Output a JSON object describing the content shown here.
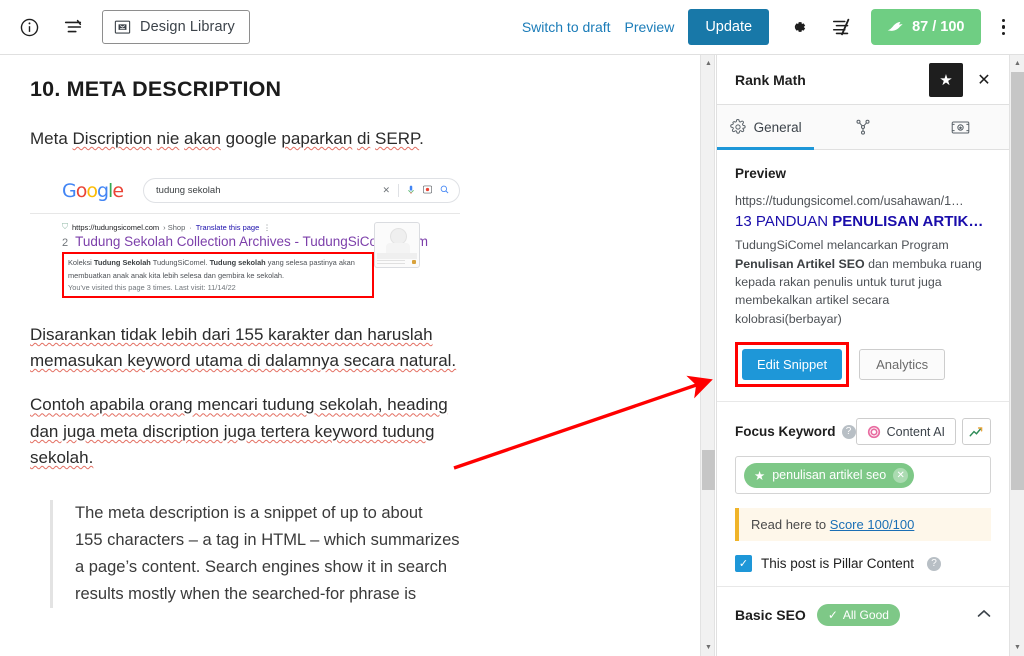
{
  "topbar": {
    "info_icon": "info-icon",
    "list_view_icon": "list-view-icon",
    "design_library_label": "Design Library",
    "design_library_icon": "design-library-icon",
    "switch_to_draft": "Switch to draft",
    "preview": "Preview",
    "update": "Update",
    "settings_icon": "gear-icon",
    "blocks_icon": "elementor-icon",
    "seo_score": "87 / 100",
    "seo_score_icon": "rank-math-icon",
    "more_icon": "kebab-menu-icon"
  },
  "editor": {
    "heading": "10. META DESCRIPTION",
    "paragraph1": "Meta Discription nie akan google paparkan di SERP.",
    "paragraph2_line1": "Disarankan tidak lebih dari 155 karakter dan haruslah",
    "paragraph2_line2": "memasukan keyword utama di dalamnya secara natural.",
    "paragraph3_line1": "Contoh apabila orang mencari tudung sekolah, heading",
    "paragraph3_line2": "dan juga meta discription juga tertera keyword tudung",
    "paragraph3_line3": "sekolah.",
    "quote_line1": "The meta description is a snippet of up to about",
    "quote_line2": "155 characters – a tag in HTML – which summarizes",
    "quote_line3": "a page’s content. Search engines show it in search",
    "quote_line4": "results mostly when the searched-for phrase is"
  },
  "serp": {
    "logo": "Google",
    "query": "tudung sekolah",
    "clear_icon": "close-icon",
    "mic_icon": "microphone-icon",
    "lens_icon": "google-lens-icon",
    "search_icon": "search-icon",
    "url": "https://tudungsicomel.com",
    "breadcrumb": "› Shop",
    "translate": "Translate this page",
    "rank": "2",
    "title": "Tudung Sekolah Collection Archives - TudungSiComel.com",
    "desc_prefix": "Koleksi ",
    "desc_bold1": "Tudung Sekolah",
    "desc_mid1": " TudungSiComel. ",
    "desc_bold2": "Tudung sekolah",
    "desc_rest": " yang selesa pastinya akan membuatkan anak anak kita lebih selesa dan gembira ke sekolah.",
    "visited": "You've visited this page 3 times. Last visit: 11/14/22"
  },
  "rankmath": {
    "title": "Rank Math",
    "star_icon": "star-icon",
    "close_icon": "close-icon",
    "tabs": [
      {
        "label": "General",
        "icon": "gear-icon",
        "active": true
      },
      {
        "label": "",
        "icon": "schema-share-icon",
        "active": false
      },
      {
        "label": "",
        "icon": "social-image-icon",
        "active": false
      }
    ],
    "preview_label": "Preview",
    "preview_url": "https://tudungsicomel.com/usahawan/1…",
    "preview_title_plain": "13 PANDUAN ",
    "preview_title_bold": "PENULISAN ARTIK…",
    "preview_desc_1": "TudungSiComel melancarkan Program ",
    "preview_desc_bold": "Penulisan Artikel SEO",
    "preview_desc_2": " dan membuka ruang kepada rakan penulis untuk turut juga membekalkan artikel secara kolobrasi(berbayar)",
    "edit_snippet": "Edit Snippet",
    "analytics": "Analytics",
    "focus_keyword_label": "Focus Keyword",
    "help_icon": "help-icon",
    "content_ai": "Content AI",
    "content_ai_icon": "content-ai-icon",
    "trend_icon": "trend-icon",
    "keyword_chip": "penulisan artikel seo",
    "keyword_chip_star": "star-icon",
    "keyword_chip_remove": "remove-keyword-icon",
    "notice_prefix": "Read here to ",
    "notice_link": "Score 100/100",
    "pillar_label": "This post is Pillar Content",
    "pillar_checked": true,
    "basic_seo_label": "Basic SEO",
    "basic_seo_badge": "All Good",
    "collapse_icon": "chevron-up-icon"
  },
  "colors": {
    "accent_blue": "#1e97d8",
    "update_blue": "#1878a8",
    "score_green": "#6fce83",
    "annotation_red": "#ff0000",
    "link_blue": "#1b7cb8"
  },
  "scrollbars": {
    "middle_up_icon": "scroll-up-arrow-icon",
    "middle_down_icon": "scroll-down-arrow-icon",
    "right_up_icon": "scroll-up-arrow-icon",
    "right_down_icon": "scroll-down-arrow-icon"
  },
  "annotation": {
    "arrow_icon": "red-pointer-arrow"
  }
}
